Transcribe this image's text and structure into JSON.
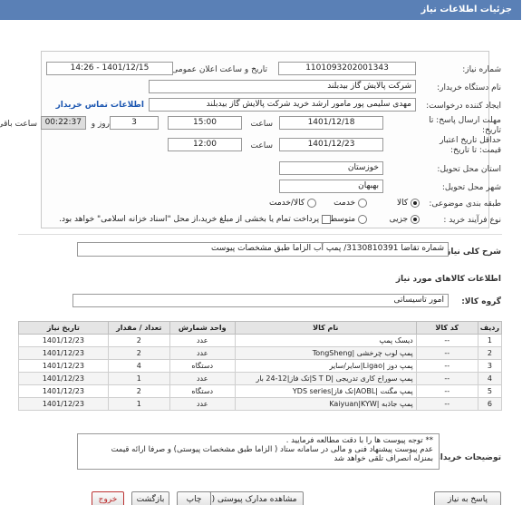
{
  "header": {
    "title": "جزئیات اطلاعات نیاز"
  },
  "form": {
    "need_number_label": "شماره نیاز:",
    "need_number": "1101093202001343",
    "announce_label": "تاریخ و ساعت اعلان عمومی:",
    "announce_value": "1401/12/15 - 14:26",
    "buyer_org_label": "نام دستگاه خریدار:",
    "buyer_org": "شرکت پالایش گاز بیدبلند",
    "creator_label": "ایجاد کننده درخواست:",
    "creator": "مهدی سلیمی پور مامور ارشد خرید شرکت پالایش گاز بیدبلند",
    "contact_link": "اطلاعات تماس خریدار",
    "deadline_label": "مهلت ارسال پاسخ: تا تاریخ:",
    "deadline_date": "1401/12/18",
    "time_label": "ساعت",
    "deadline_time": "15:00",
    "days_value": "3",
    "days_label": "روز و",
    "remaining_time": "00:22:37",
    "remaining_label": "ساعت باقی مانده",
    "validity_label": "حداقل تاریخ اعتبار قیمت: تا تاریخ:",
    "validity_date": "1401/12/23",
    "validity_time_label": "ساعت",
    "validity_time": "12:00",
    "province_label": "استان محل تحویل:",
    "province": "خوزستان",
    "city_label": "شهر محل تحویل:",
    "city": "بهبهان",
    "category_label": "طبقه بندی موضوعی:",
    "category_options": [
      "کالا",
      "خدمت",
      "کالا/خدمت"
    ],
    "process_label": "نوع فرآیند خرید :",
    "process_options": [
      "جزیی",
      "متوسط"
    ],
    "payment_note": "پرداخت تمام یا بخشی از مبلغ خرید،از محل \"اسناد خزانه اسلامی\" خواهد بود."
  },
  "summary": {
    "label": "شرح کلی نیاز:",
    "value": "شماره تقاضا 3130810391/ پمپ آب الزاما طبق مشخصات پیوست"
  },
  "goods": {
    "section_title": "اطلاعات کالاهای مورد نیاز",
    "group_label": "گروه کالا:",
    "group_value": "امور تاسیساتی"
  },
  "table": {
    "headers": [
      "ردیف",
      "کد کالا",
      "نام کالا",
      "واحد شمارش",
      "تعداد / مقدار",
      "تاریخ نیاز"
    ],
    "rows": [
      [
        "1",
        "--",
        "دیسک پمپ",
        "عدد",
        "2",
        "1401/12/23"
      ],
      [
        "2",
        "--",
        "پمپ لوب چرخشی |TongSheng",
        "عدد",
        "2",
        "1401/12/23"
      ],
      [
        "3",
        "--",
        "پمپ دوز |Ligao|سایر/سایر",
        "دستگاه",
        "4",
        "1401/12/23"
      ],
      [
        "4",
        "--",
        "پمپ سوراخ کاری تدریجی |S T D|تک فاز|12-24 بار",
        "عدد",
        "1",
        "1401/12/23"
      ],
      [
        "5",
        "--",
        "پمپ مگنت |AOBL|تک فاز|YDS series",
        "دستگاه",
        "2",
        "1401/12/23"
      ],
      [
        "6",
        "--",
        "پمپ جاذبه |Kaiyuan|KYW",
        "عدد",
        "1",
        "1401/12/23"
      ]
    ]
  },
  "buyer_notes": {
    "label": "توضیحات خریدار:",
    "lines": [
      "** توجه پیوست ها را با دقت مطالعه فرمایید .",
      "عدم پیوست پیشنهاد فنی و مالی در سامانه ستاد ( الزاما طبق مشخصات پیوستی) و صرفا ارائه قیمت",
      "بمنزله انصراف تلقی خواهد شد"
    ]
  },
  "buttons": {
    "reply": "پاسخ به نیاز",
    "view_docs": "مشاهده مدارک پیوستی (2)",
    "print": "چاپ",
    "back": "بازگشت",
    "exit": "خروج"
  }
}
